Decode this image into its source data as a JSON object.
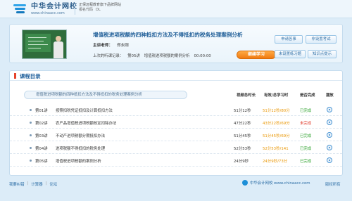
{
  "header": {
    "logo_cn": "中华会计网校",
    "logo_en": "www.chinaacc.com",
    "slogan": "正保远程教育旗下品牌网站",
    "help_links": [
      "报名代码",
      "DL"
    ]
  },
  "course": {
    "title": "增值税进项税额的四种抵扣方法及不得抵扣的税务处理案例分析",
    "teacher_label": "主讲老师：",
    "teacher_name": "郑永刚",
    "last_record_label": "上次的听课记录：",
    "last_record_lesson": "第05讲",
    "last_record_title": "增值税进项税额的案例分析",
    "last_record_time": "00:00:00",
    "continue_button": "继续学习",
    "buttons": {
      "qa": "申请答事",
      "evaluate": "非设置考试",
      "exercise": "未设置练习题",
      "knowledge": "知识点提示"
    }
  },
  "directory": {
    "title": "课程目录",
    "category": "增值税进项税额的四种抵扣方法及不得抵扣的税务处理案例分析",
    "columns": {
      "duration": "视频总时长",
      "effective": "有效/总学习时",
      "done": "是否完成",
      "play": "播放"
    },
    "lessons": [
      {
        "num": "第01讲",
        "name": "按照扣税凭证抵扣及计算抵扣方法",
        "duration": "51分12秒",
        "eff_a": "51分12秒",
        "eff_b": "/80分",
        "status": "已完成",
        "status_color": "#2aa12a"
      },
      {
        "num": "第02讲",
        "name": "农产品增值税进项税额核定扣除办法",
        "duration": "47分22秒",
        "eff_a": "43分22秒",
        "eff_b": "/69分",
        "status": "未完成",
        "status_color": "#e03a2a"
      },
      {
        "num": "第03讲",
        "name": "不动产进项税额分期抵扣办法",
        "duration": "51分45秒",
        "eff_a": "51分45秒",
        "eff_b": "/69分",
        "status": "已完成",
        "status_color": "#2aa12a"
      },
      {
        "num": "第04讲",
        "name": "进项税额不得抵扣的税务处理",
        "duration": "52分53秒",
        "eff_a": "52分53秒",
        "eff_b": "/141",
        "status": "已完成",
        "status_color": "#2aa12a"
      },
      {
        "num": "第05讲",
        "name": "增值税进项税额的案例分析",
        "duration": "24分9秒",
        "eff_a": "24分9秒",
        "eff_b": "/73分",
        "status": "已完成",
        "status_color": "#2aa12a"
      }
    ]
  },
  "footer": {
    "links": [
      "我要纠错",
      "计算器",
      "论坛"
    ],
    "logo_text": "中华会计网校 www.chinaacc.com",
    "copyright": "版权所有"
  }
}
